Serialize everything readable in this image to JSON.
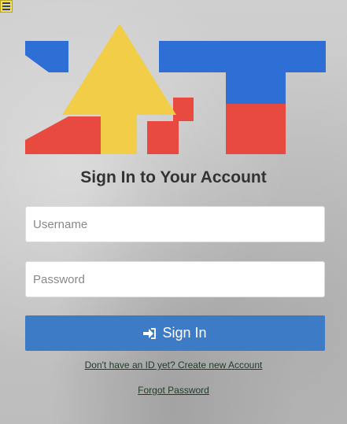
{
  "menu": {
    "icon": "hamburger-menu-icon"
  },
  "logo": {
    "text": "LIFT",
    "colors": {
      "blue": "#2e6fd6",
      "yellow": "#f1cd48",
      "red": "#e94a3f",
      "white": "#ffffff"
    }
  },
  "form": {
    "title": "Sign In to Your Account",
    "username_placeholder": "Username",
    "password_placeholder": "Password",
    "signin_label": "Sign In",
    "signin_icon": "sign-in-icon",
    "create_account_link": "Don't have an ID yet? Create new Account",
    "forgot_password_link": "Forgot Password"
  },
  "colors": {
    "button": "#3d7bc7",
    "link": "#1f3d26",
    "title": "#333333"
  }
}
